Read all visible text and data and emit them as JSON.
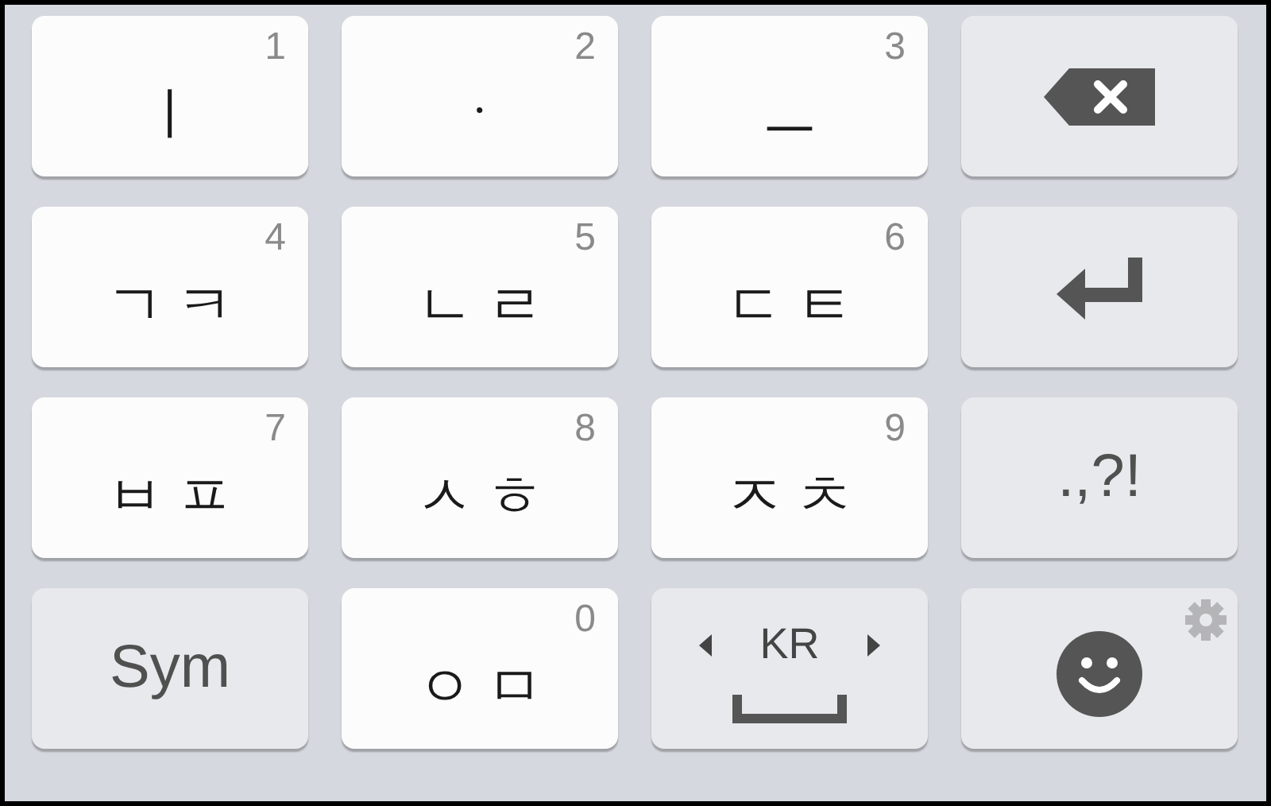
{
  "keys": [
    {
      "kind": "char",
      "label": "ㅣ",
      "number": "1"
    },
    {
      "kind": "char",
      "label": "ㆍ",
      "number": "2"
    },
    {
      "kind": "char",
      "label": "ㅡ",
      "number": "3"
    },
    {
      "kind": "backspace"
    },
    {
      "kind": "char",
      "label": "ㄱㅋ",
      "number": "4"
    },
    {
      "kind": "char",
      "label": "ㄴㄹ",
      "number": "5"
    },
    {
      "kind": "char",
      "label": "ㄷㅌ",
      "number": "6"
    },
    {
      "kind": "enter"
    },
    {
      "kind": "char",
      "label": "ㅂㅍ",
      "number": "7"
    },
    {
      "kind": "char",
      "label": "ㅅㅎ",
      "number": "8"
    },
    {
      "kind": "char",
      "label": "ㅈㅊ",
      "number": "9"
    },
    {
      "kind": "text",
      "label": ".,?!"
    },
    {
      "kind": "text",
      "label": "Sym"
    },
    {
      "kind": "char",
      "label": "ㅇㅁ",
      "number": "0"
    },
    {
      "kind": "space",
      "label": "KR"
    },
    {
      "kind": "emoji"
    }
  ]
}
